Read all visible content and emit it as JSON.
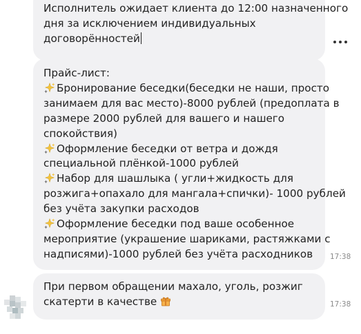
{
  "messages": [
    {
      "lines": [
        "Исполнитель ожидает клиента до 12:00 назначенного",
        "дня за исключением индивидуальных",
        "договорённостей"
      ]
    },
    {
      "lines": [
        {
          "icon": "",
          "text": "Прайс-лист:"
        },
        {
          "icon": "sparkle-icon",
          "text": "Бронирование беседки(беседки не наши, просто"
        },
        {
          "icon": "",
          "text": "занимаем для вас место)-8000 рублей (предоплата в"
        },
        {
          "icon": "",
          "text": "размере 2000 рублей для вашего и нашего"
        },
        {
          "icon": "",
          "text": "спокойствия)"
        },
        {
          "icon": "sparkle-icon",
          "text": "Оформление беседки от ветра и дождя"
        },
        {
          "icon": "",
          "text": "специальной плёнкой-1000 рублей"
        },
        {
          "icon": "sparkle-icon",
          "text": "Набор для шашлыка ( угли+жидкость для"
        },
        {
          "icon": "",
          "text": "розжига+опахало для мангала+спички)- 1000 рублей"
        },
        {
          "icon": "",
          "text": "без учёта закупки расходов"
        },
        {
          "icon": "sparkle-icon",
          "text": "Оформление беседки под ваше особенное"
        },
        {
          "icon": "",
          "text": "мероприятие (украшение шариками, растяжками с"
        },
        {
          "icon": "",
          "text": "надписями)-1000 рублей без учёта расходников"
        }
      ],
      "time": "17:38"
    },
    {
      "lines": [
        "При первом обращении махало, уголь, розжиг",
        "скатерти в качестве"
      ],
      "trailing_icon": "gift-icon",
      "time": "17:38"
    }
  ],
  "colors": {
    "bubble": "#f1f1f3",
    "text": "#222222",
    "time": "#8a8a8a"
  }
}
